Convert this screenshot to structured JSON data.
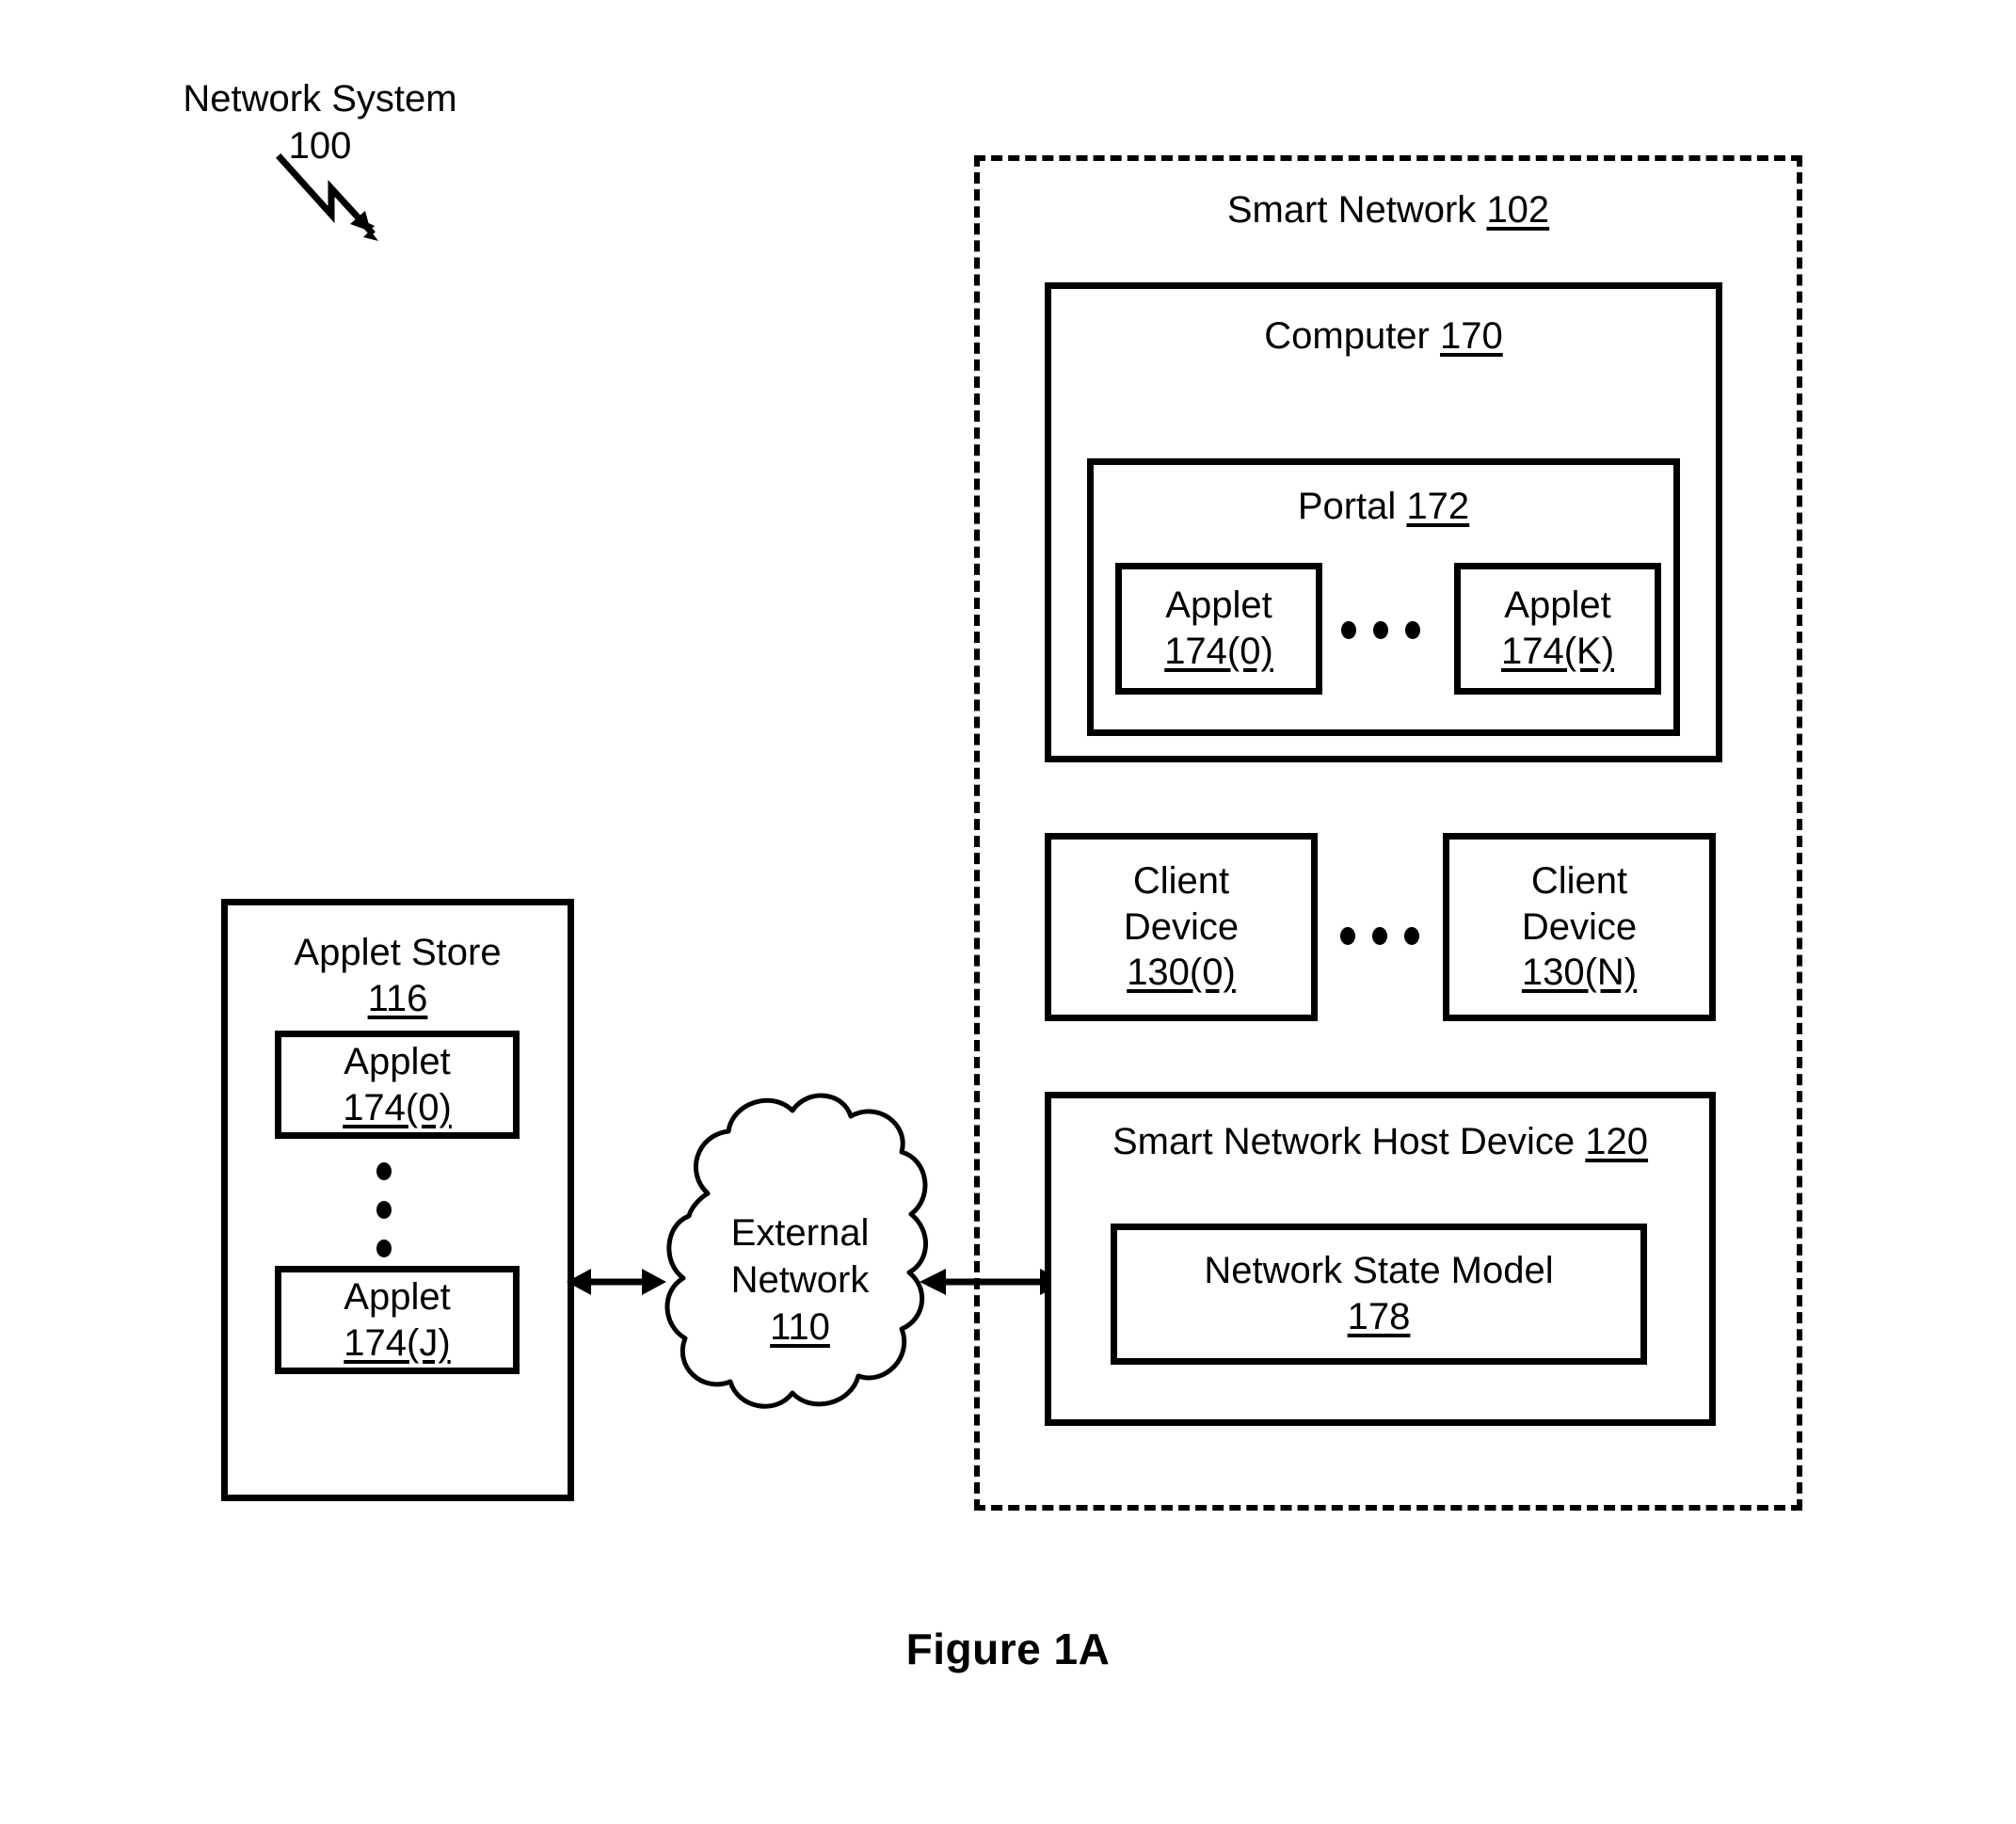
{
  "figure": {
    "caption": "Figure 1A",
    "callout_label": "Network System",
    "callout_number": "100"
  },
  "smart_network": {
    "label": "Smart Network",
    "ref": "102",
    "computer": {
      "label": "Computer",
      "ref": "170",
      "portal": {
        "label": "Portal",
        "ref": "172",
        "applets": [
          {
            "label": "Applet",
            "ref": "174(0)"
          },
          {
            "label": "Applet",
            "ref": "174(K)"
          }
        ],
        "ellipsis": "•••"
      }
    },
    "client_devices": [
      {
        "line1": "Client",
        "line2": "Device",
        "ref": "130(0)"
      },
      {
        "line1": "Client",
        "line2": "Device",
        "ref": "130(N)"
      }
    ],
    "client_ellipsis": "•••",
    "host_device": {
      "label": "Smart Network Host Device",
      "ref": "120",
      "network_state_model": {
        "label": "Network State Model",
        "ref": "178"
      }
    }
  },
  "applet_store": {
    "label": "Applet Store",
    "ref": "116",
    "applets": [
      {
        "label": "Applet",
        "ref": "174(0)"
      },
      {
        "label": "Applet",
        "ref": "174(J)"
      }
    ],
    "vertical_ellipsis": "⋮"
  },
  "external_network": {
    "line1": "External",
    "line2": "Network",
    "ref": "110"
  },
  "colors": {
    "stroke": "#000000",
    "background": "#ffffff"
  }
}
